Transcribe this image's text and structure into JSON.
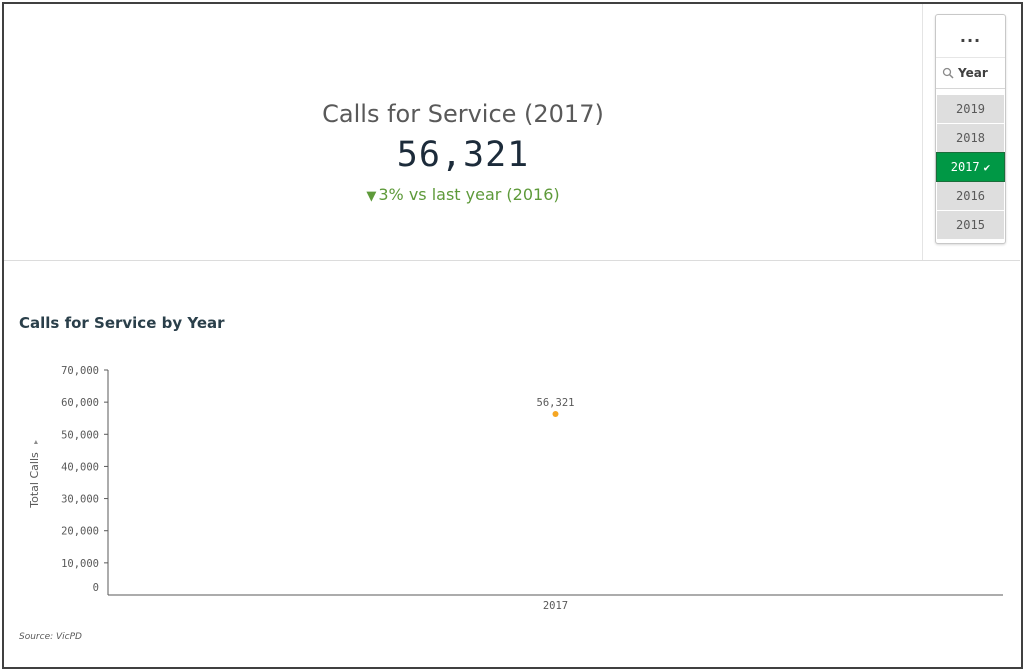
{
  "kpi": {
    "title": "Calls for Service (2017)",
    "value": "56,321",
    "delta_arrow": "▼",
    "delta_text": "3% vs last year (2016)",
    "delta_color": "#5e9a3a"
  },
  "filter": {
    "menu_label": "...",
    "field_icon": "search-icon",
    "field_label": "Year",
    "items": [
      {
        "label": "2019",
        "selected": false
      },
      {
        "label": "2018",
        "selected": false
      },
      {
        "label": "2017",
        "selected": true,
        "check": "✔"
      },
      {
        "label": "2016",
        "selected": false
      },
      {
        "label": "2015",
        "selected": false
      }
    ],
    "selected_color": "#009845"
  },
  "chart": {
    "title": "Calls for Service by Year",
    "source": "Source: VicPD",
    "y_axis_toggle": "▸"
  },
  "chart_data": {
    "type": "scatter",
    "title": "Calls for Service by Year",
    "xlabel": "",
    "ylabel": "Total Calls",
    "categories": [
      "2017"
    ],
    "values": [
      56321
    ],
    "data_labels": [
      "56,321"
    ],
    "y_ticks": [
      "70,000",
      "60,000",
      "50,000",
      "40,000",
      "30,000",
      "20,000",
      "10,000",
      "0"
    ],
    "y_tick_values": [
      70000,
      60000,
      50000,
      40000,
      30000,
      20000,
      10000,
      0
    ],
    "ylim": [
      0,
      70000
    ],
    "point_color": "#f5a623",
    "grid": false,
    "legend": "none"
  }
}
